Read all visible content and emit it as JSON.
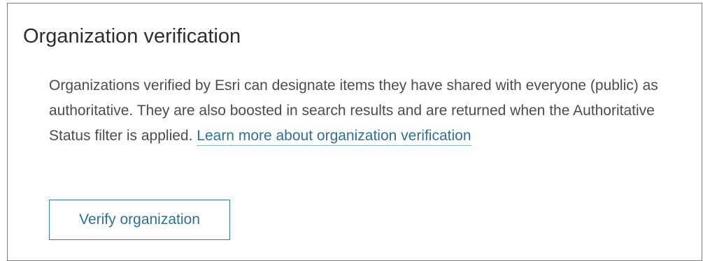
{
  "section": {
    "title": "Organization verification",
    "description": "Organizations verified by Esri can designate items they have shared with everyone (public) as authoritative. They are also boosted in search results and are returned when the Authoritative Status filter is applied.",
    "link_text": "Learn more about organization verification",
    "button_label": "Verify organization"
  },
  "colors": {
    "link": "#2f6f96",
    "button_border": "#2f7cb0",
    "panel_border": "#7c7c7c"
  }
}
